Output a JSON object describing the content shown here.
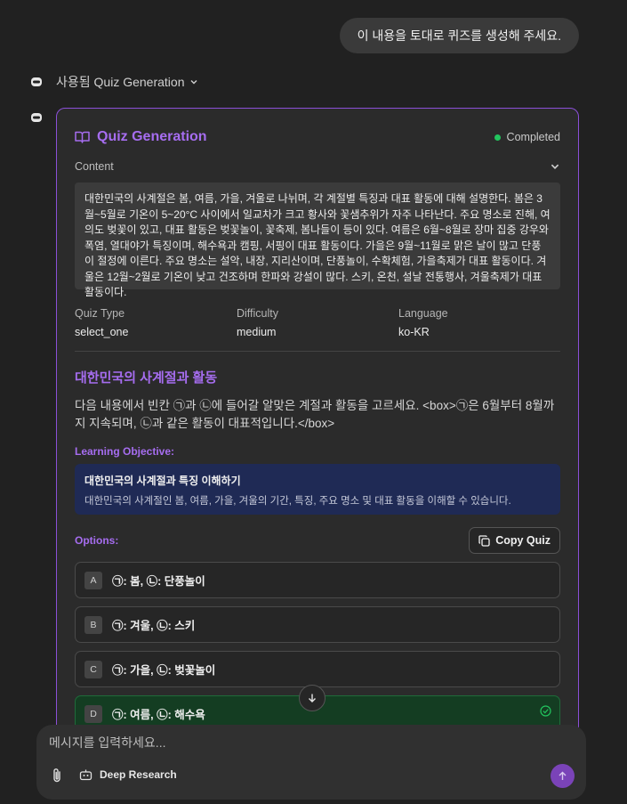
{
  "user_message": "이 내용을 토대로 퀴즈를 생성해 주세요.",
  "tool_used_label": "사용됨 Quiz Generation",
  "card": {
    "title": "Quiz Generation",
    "status": "Completed",
    "content_label": "Content",
    "content_text": "대한민국의 사계절은 봄, 여름, 가을, 겨울로 나뉘며, 각 계절별 특징과 대표 활동에 대해 설명한다. 봄은 3월~5월로 기온이 5~20°C 사이에서 일교차가 크고 황사와 꽃샘추위가 자주 나타난다. 주요 명소로 진해, 여의도 벚꽃이 있고, 대표 활동은 벚꽃놀이, 꽃축제, 봄나들이 등이 있다. 여름은 6월~8월로 장마 집중 강우와 폭염, 열대야가 특징이며, 해수욕과 캠핑, 서핑이 대표 활동이다. 가을은 9월~11월로 맑은 날이 많고 단풍이 절정에 이른다. 주요 명소는 설악, 내장, 지리산이며, 단풍놀이, 수확체험, 가을축제가 대표 활동이다. 겨울은 12월~2월로 기온이 낮고 건조하며 한파와 강설이 많다. 스키, 온천, 설날 전통행사, 겨울축제가 대표 활동이다.",
    "meta": [
      {
        "label": "Quiz Type",
        "value": "select_one"
      },
      {
        "label": "Difficulty",
        "value": "medium"
      },
      {
        "label": "Language",
        "value": "ko-KR"
      }
    ],
    "quiz_title": "대한민국의 사계절과 활동",
    "question": "다음 내용에서 빈칸 ㉠과 ㉡에 들어갈 알맞은 계절과 활동을 고르세요. <box>㉠은 6월부터 8월까지 지속되며, ㉡과 같은 활동이 대표적입니다.</box>",
    "learning_objective_label": "Learning Objective:",
    "learning_objective_title": "대한민국의 사계절과 특징 이해하기",
    "learning_objective_desc": "대한민국의 사계절인 봄, 여름, 가을, 겨울의 기간, 특징, 주요 명소 및 대표 활동을 이해할 수 있습니다.",
    "options_label": "Options:",
    "copy_button": "Copy Quiz",
    "options": [
      {
        "letter": "A",
        "text": "㉠: 봄, ㉡: 단풍놀이"
      },
      {
        "letter": "B",
        "text": "㉠: 겨울, ㉡: 스키"
      },
      {
        "letter": "C",
        "text": "㉠: 가을, ㉡: 벚꽃놀이"
      },
      {
        "letter": "D",
        "text": "㉠: 여름, ㉡: 해수욕",
        "correct": true
      }
    ]
  },
  "input": {
    "placeholder": "메시지를 입력하세요...",
    "deep_research": "Deep Research"
  },
  "colors": {
    "accent": "#a66df0",
    "border": "#8b4fd8",
    "success": "#22c55e",
    "send": "#7a43b8"
  }
}
